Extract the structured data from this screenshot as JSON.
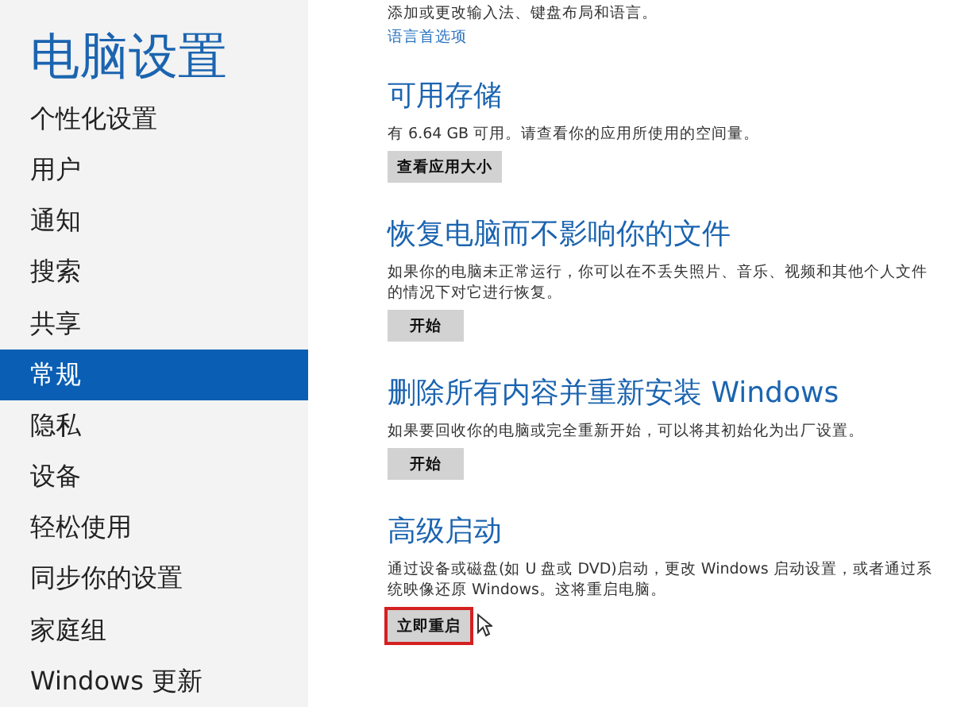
{
  "sidebar": {
    "title": "电脑设置",
    "items": [
      {
        "label": "个性化设置",
        "selected": false
      },
      {
        "label": "用户",
        "selected": false
      },
      {
        "label": "通知",
        "selected": false
      },
      {
        "label": "搜索",
        "selected": false
      },
      {
        "label": "共享",
        "selected": false
      },
      {
        "label": "常规",
        "selected": true
      },
      {
        "label": "隐私",
        "selected": false
      },
      {
        "label": "设备",
        "selected": false
      },
      {
        "label": "轻松使用",
        "selected": false
      },
      {
        "label": "同步你的设置",
        "selected": false
      },
      {
        "label": "家庭组",
        "selected": false
      },
      {
        "label": "Windows 更新",
        "selected": false
      }
    ]
  },
  "top": {
    "description": "添加或更改输入法、键盘布局和语言。",
    "link": "语言首选项"
  },
  "sections": [
    {
      "heading": "可用存储",
      "description": "有 6.64 GB 可用。请查看你的应用所使用的空间量。",
      "button": "查看应用大小",
      "highlighted": false
    },
    {
      "heading": "恢复电脑而不影响你的文件",
      "description": "如果你的电脑未正常运行，你可以在不丢失照片、音乐、视频和其他个人文件的情况下对它进行恢复。",
      "button": "开始",
      "highlighted": false
    },
    {
      "heading": "删除所有内容并重新安装 Windows",
      "description": "如果要回收你的电脑或完全重新开始，可以将其初始化为出厂设置。",
      "button": "开始",
      "highlighted": false
    },
    {
      "heading": "高级启动",
      "description": "通过设备或磁盘(如 U 盘或 DVD)启动，更改 Windows 启动设置，或者通过系统映像还原 Windows。这将重启电脑。",
      "button": "立即重启",
      "highlighted": true
    }
  ]
}
